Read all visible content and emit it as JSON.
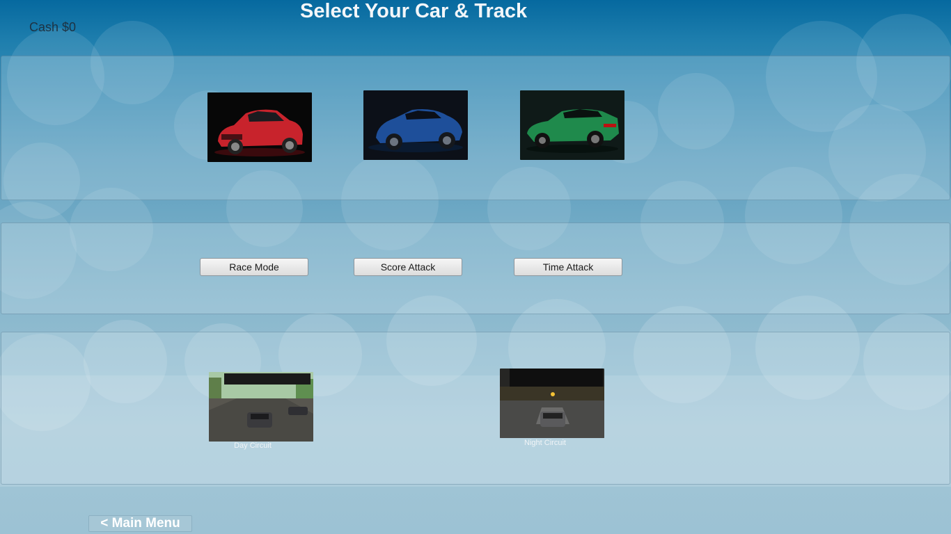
{
  "header": {
    "title": "Select Your Car & Track",
    "cash": "Cash $0"
  },
  "cars": [
    {
      "name": "red-sedan",
      "color": "#c8232c"
    },
    {
      "name": "blue-coupe",
      "color": "#1e4f9a"
    },
    {
      "name": "green-muscle",
      "color": "#1f8a4c"
    }
  ],
  "modes": [
    "Race Mode",
    "Score Attack",
    "Time Attack"
  ],
  "tracks": [
    {
      "label": "Day Circuit"
    },
    {
      "label": "Night Circuit"
    }
  ],
  "footer": {
    "main_menu_label": "< Main Menu"
  }
}
